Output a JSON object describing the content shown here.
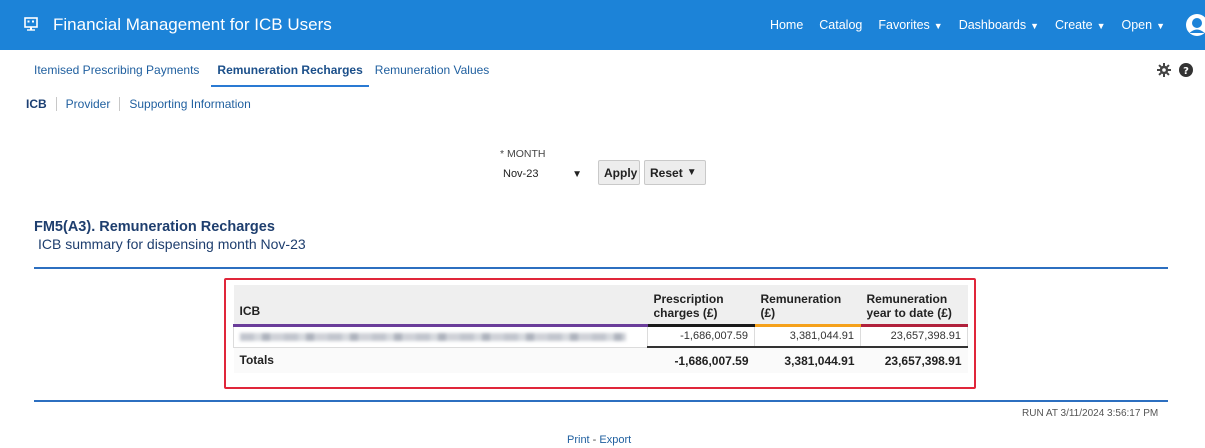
{
  "header": {
    "app_title": "Financial Management for ICB Users",
    "nav": [
      {
        "label": "Home",
        "dropdown": false
      },
      {
        "label": "Catalog",
        "dropdown": false
      },
      {
        "label": "Favorites",
        "dropdown": true
      },
      {
        "label": "Dashboards",
        "dropdown": true
      },
      {
        "label": "Create",
        "dropdown": true
      },
      {
        "label": "Open",
        "dropdown": true
      }
    ],
    "bar_color": "#1c83d8"
  },
  "tabs": [
    {
      "label": "Itemised Prescribing Payments",
      "active": false
    },
    {
      "label": "Remuneration Recharges",
      "active": true
    },
    {
      "label": "Remuneration Values",
      "active": false
    }
  ],
  "subtabs": [
    {
      "label": "ICB",
      "active": true
    },
    {
      "label": "Provider",
      "active": false
    },
    {
      "label": "Supporting Information",
      "active": false
    }
  ],
  "prompt": {
    "month_label": "* MONTH",
    "month_value": "Nov-23",
    "apply_label": "Apply",
    "reset_label": "Reset"
  },
  "report": {
    "title": "FM5(A3). Remuneration Recharges",
    "subtitle": "ICB summary for dispensing month Nov-23",
    "columns": [
      "ICB",
      "Prescription charges (£)",
      "Remuneration (£)",
      "Remuneration year to date (£)"
    ],
    "row": {
      "icb": "",
      "prescription_charges": "-1,686,007.59",
      "remuneration": "3,381,044.91",
      "remuneration_ytd": "23,657,398.91"
    },
    "totals": {
      "label": "Totals",
      "prescription_charges": "-1,686,007.59",
      "remuneration": "3,381,044.91",
      "remuneration_ytd": "23,657,398.91"
    }
  },
  "footer": {
    "run_at": "RUN AT 3/11/2024 3:56:17 PM",
    "print_label": "Print",
    "separator": " - ",
    "export_label": "Export"
  }
}
